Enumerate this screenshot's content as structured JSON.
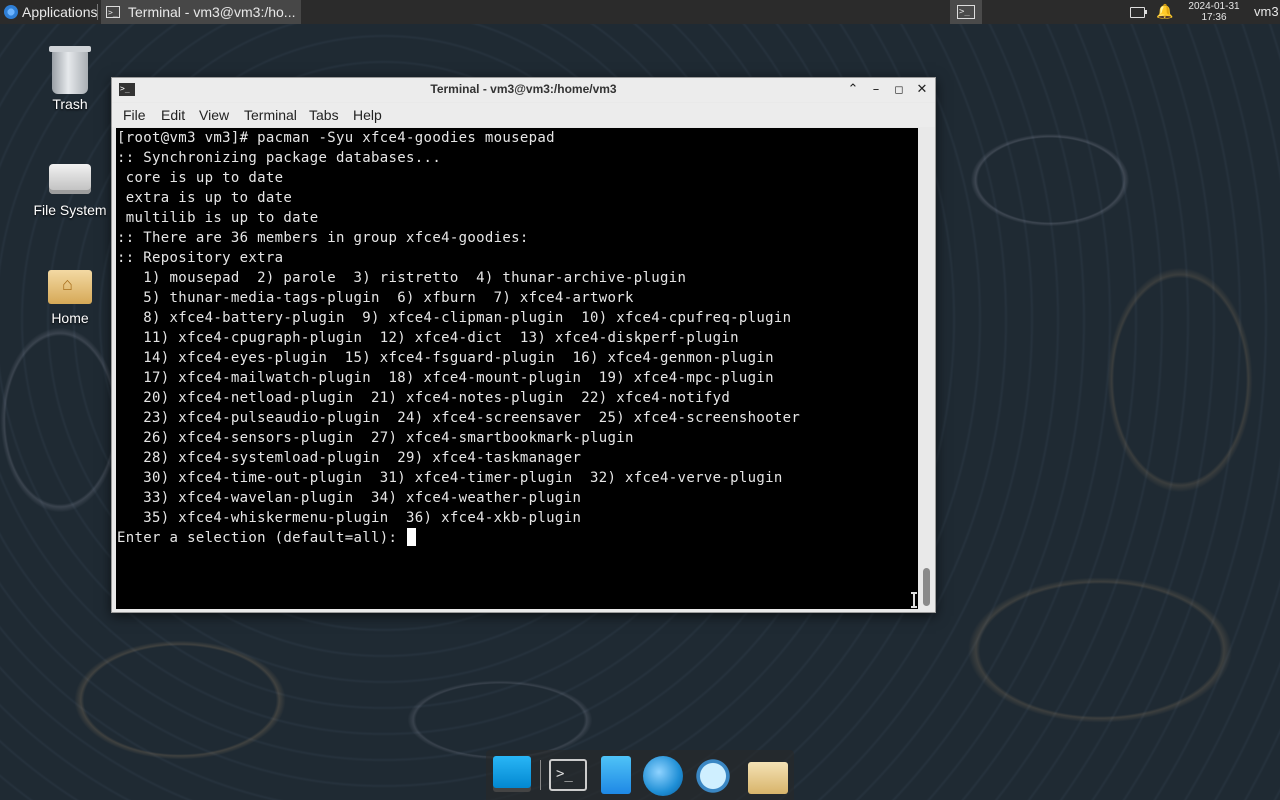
{
  "top_panel": {
    "applications_label": "Applications",
    "task_label": "Terminal - vm3@vm3:/ho...",
    "clock_date": "2024-01-31",
    "clock_time": "17:36",
    "user": "vm3"
  },
  "desktop": {
    "icons": [
      {
        "label": "Trash",
        "icon": "trash-icon"
      },
      {
        "label": "File System",
        "icon": "drive-icon"
      },
      {
        "label": "Home",
        "icon": "home-folder-icon"
      }
    ]
  },
  "window": {
    "title": "Terminal - vm3@vm3:/home/vm3",
    "controls": [
      "shade",
      "minimize",
      "maximize",
      "close"
    ],
    "menu": [
      "File",
      "Edit",
      "View",
      "Terminal",
      "Tabs",
      "Help"
    ]
  },
  "terminal": {
    "lines": [
      "[root@vm3 vm3]# pacman -Syu xfce4-goodies mousepad",
      ":: Synchronizing package databases...",
      " core is up to date",
      " extra is up to date",
      " multilib is up to date",
      ":: There are 36 members in group xfce4-goodies:",
      ":: Repository extra",
      "   1) mousepad  2) parole  3) ristretto  4) thunar-archive-plugin",
      "   5) thunar-media-tags-plugin  6) xfburn  7) xfce4-artwork",
      "   8) xfce4-battery-plugin  9) xfce4-clipman-plugin  10) xfce4-cpufreq-plugin",
      "   11) xfce4-cpugraph-plugin  12) xfce4-dict  13) xfce4-diskperf-plugin",
      "   14) xfce4-eyes-plugin  15) xfce4-fsguard-plugin  16) xfce4-genmon-plugin",
      "   17) xfce4-mailwatch-plugin  18) xfce4-mount-plugin  19) xfce4-mpc-plugin",
      "   20) xfce4-netload-plugin  21) xfce4-notes-plugin  22) xfce4-notifyd",
      "   23) xfce4-pulseaudio-plugin  24) xfce4-screensaver  25) xfce4-screenshooter",
      "   26) xfce4-sensors-plugin  27) xfce4-smartbookmark-plugin",
      "   28) xfce4-systemload-plugin  29) xfce4-taskmanager",
      "   30) xfce4-time-out-plugin  31) xfce4-timer-plugin  32) xfce4-verve-plugin",
      "   33) xfce4-wavelan-plugin  34) xfce4-weather-plugin",
      "   35) xfce4-whiskermenu-plugin  36) xfce4-xkb-plugin",
      "",
      "Enter a selection (default=all): "
    ]
  },
  "dock": {
    "items": [
      "show-desktop-icon",
      "terminal-icon",
      "file-manager-icon",
      "web-browser-icon",
      "app-finder-icon",
      "folder-icon"
    ]
  }
}
